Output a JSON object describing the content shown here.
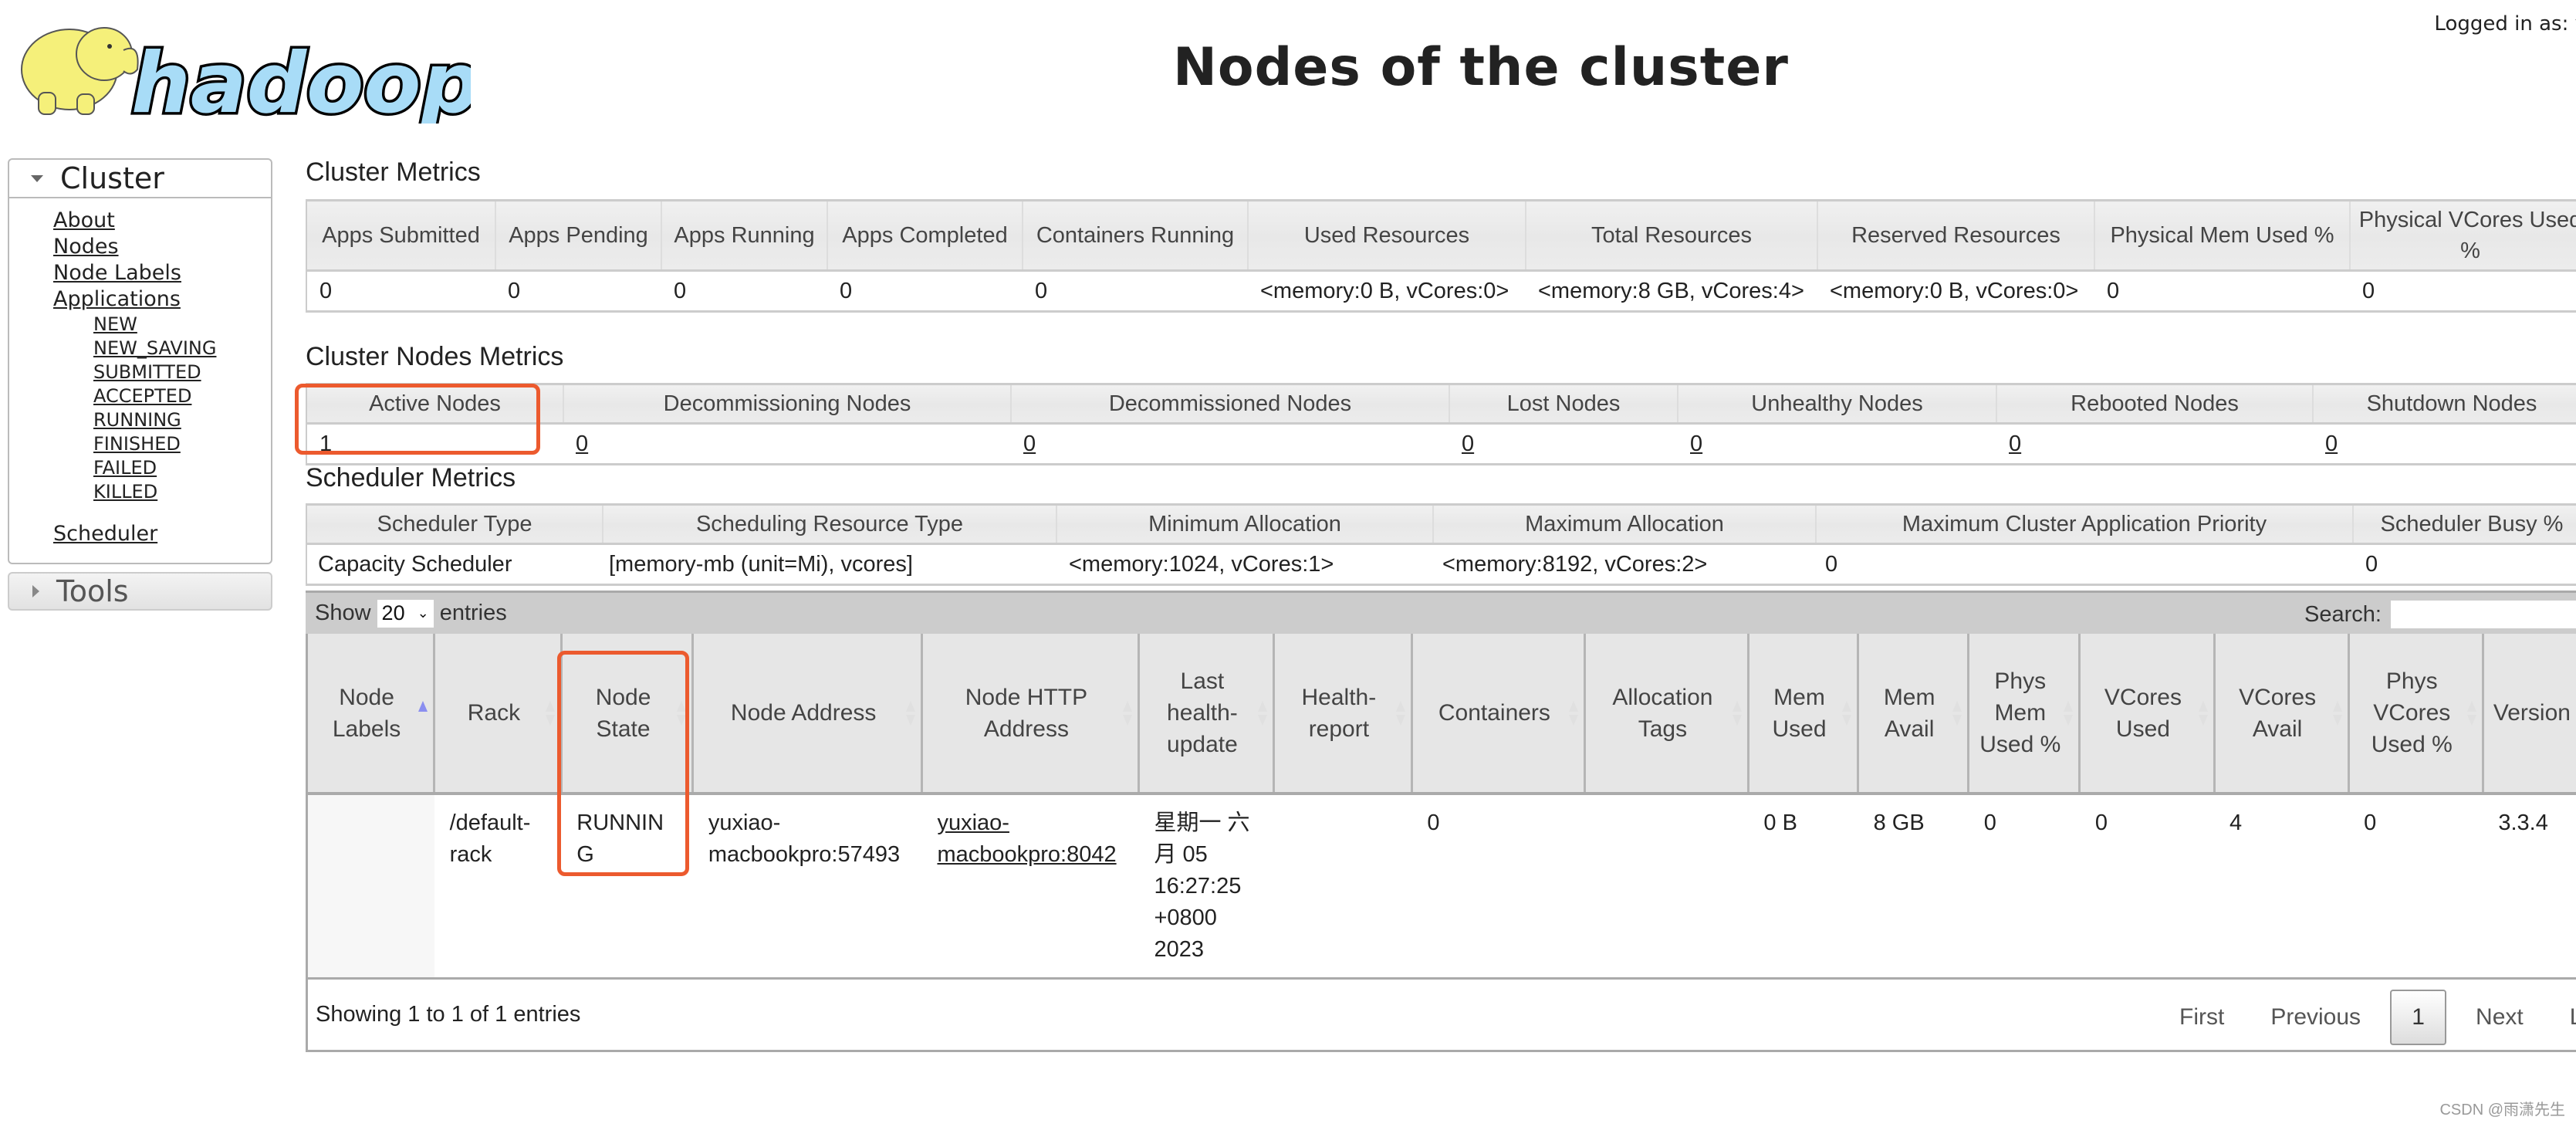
{
  "header": {
    "logo_text": "hadoop",
    "title": "Nodes of the cluster",
    "logged_in": "Logged in as: y"
  },
  "colors": {
    "highlight": "#ec5a2e",
    "logo_elephant": "#f5f07a",
    "logo_text": "#a8dcf7",
    "toolbar_bg": "#cccccc"
  },
  "sidebar": {
    "cluster": {
      "label": "Cluster",
      "links": [
        "About",
        "Nodes",
        "Node Labels",
        "Applications"
      ],
      "app_states": [
        "NEW",
        "NEW_SAVING",
        "SUBMITTED",
        "ACCEPTED",
        "RUNNING",
        "FINISHED",
        "FAILED",
        "KILLED"
      ],
      "scheduler": "Scheduler"
    },
    "tools": {
      "label": "Tools"
    }
  },
  "cluster_metrics": {
    "title": "Cluster Metrics",
    "headers": [
      "Apps Submitted",
      "Apps Pending",
      "Apps Running",
      "Apps Completed",
      "Containers Running",
      "Used Resources",
      "Total Resources",
      "Reserved Resources",
      "Physical Mem Used %",
      "Physical VCores Used %"
    ],
    "values": [
      "0",
      "0",
      "0",
      "0",
      "0",
      "<memory:0 B, vCores:0>",
      "<memory:8 GB, vCores:4>",
      "<memory:0 B, vCores:0>",
      "0",
      "0"
    ]
  },
  "cluster_nodes_metrics": {
    "title": "Cluster Nodes Metrics",
    "headers": [
      "Active Nodes",
      "Decommissioning Nodes",
      "Decommissioned Nodes",
      "Lost Nodes",
      "Unhealthy Nodes",
      "Rebooted Nodes",
      "Shutdown Nodes"
    ],
    "values": [
      "1",
      "0",
      "0",
      "0",
      "0",
      "0",
      "0"
    ]
  },
  "scheduler_metrics": {
    "title": "Scheduler Metrics",
    "headers": [
      "Scheduler Type",
      "Scheduling Resource Type",
      "Minimum Allocation",
      "Maximum Allocation",
      "Maximum Cluster Application Priority",
      "Scheduler Busy %"
    ],
    "values": [
      "Capacity Scheduler",
      "[memory-mb (unit=Mi), vcores]",
      "<memory:1024, vCores:1>",
      "<memory:8192, vCores:2>",
      "0",
      "0"
    ]
  },
  "nodes_table": {
    "show_label": "Show",
    "page_length": "20",
    "entries_label": "entries",
    "search_label": "Search:",
    "search_value": "",
    "headers": [
      "Node Labels",
      "Rack",
      "Node State",
      "Node Address",
      "Node HTTP Address",
      "Last health-update",
      "Health-report",
      "Containers",
      "Allocation Tags",
      "Mem Used",
      "Mem Avail",
      "Phys Mem Used %",
      "VCores Used",
      "VCores Avail",
      "Phys VCores Used %",
      "Version"
    ],
    "rows": [
      [
        "",
        "/default-rack",
        "RUNNING",
        "yuxiao-macbookpro:57493",
        "yuxiao-macbookpro:8042",
        "星期一 六月 05 16:27:25 +0800 2023",
        "",
        "0",
        "",
        "0 B",
        "8 GB",
        "0",
        "0",
        "4",
        "0",
        "3.3.4"
      ]
    ],
    "info": "Showing 1 to 1 of 1 entries",
    "pager": {
      "first": "First",
      "previous": "Previous",
      "current": "1",
      "next": "Next",
      "last": "La"
    }
  },
  "watermark": "CSDN @雨潇先生"
}
